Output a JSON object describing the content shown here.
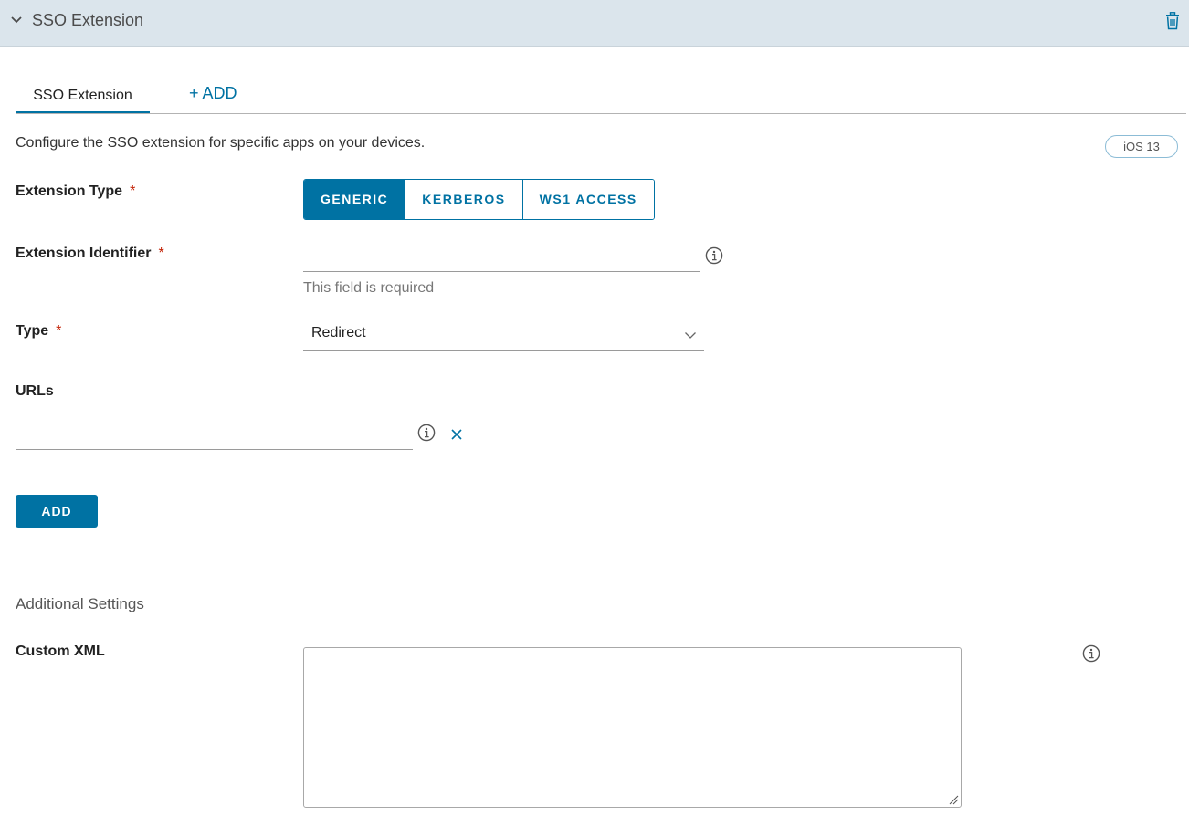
{
  "header": {
    "title": "SSO Extension",
    "delete_icon": "trash-icon"
  },
  "tabs": [
    {
      "label": "SSO Extension",
      "active": true
    },
    {
      "label": "+ ADD",
      "active": false
    }
  ],
  "description": "Configure the SSO extension for specific apps on your devices.",
  "badge": "iOS 13",
  "required_marker": "*",
  "extension_type": {
    "label": "Extension Type",
    "options": [
      "GENERIC",
      "KERBEROS",
      "WS1 ACCESS"
    ],
    "selected": "GENERIC"
  },
  "extension_identifier": {
    "label": "Extension Identifier",
    "value": "",
    "error": "This field is required"
  },
  "type": {
    "label": "Type",
    "value": "Redirect"
  },
  "urls": {
    "label": "URLs",
    "value": "",
    "add_label": "ADD"
  },
  "additional_settings": {
    "title": "Additional Settings",
    "custom_xml_label": "Custom XML",
    "custom_xml_value": ""
  },
  "colors": {
    "accent": "#0072a3",
    "header_bg": "#dbe5ec",
    "required": "#c21d00"
  }
}
